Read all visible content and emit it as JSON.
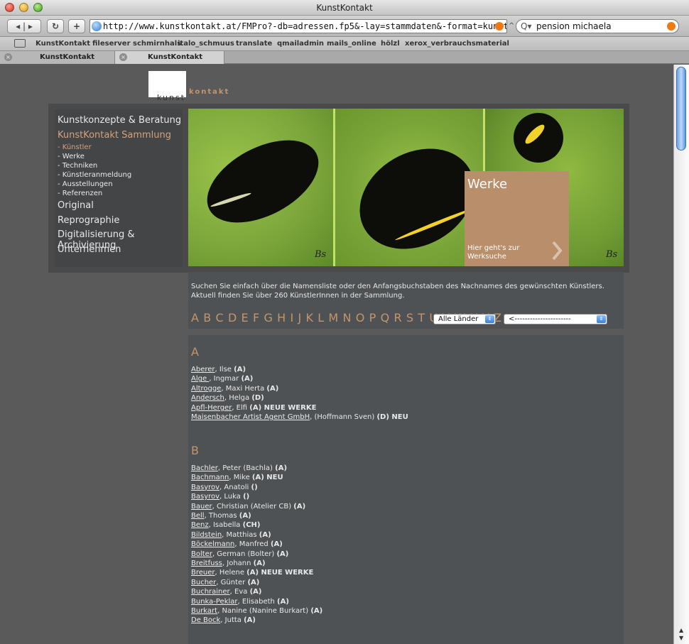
{
  "window": {
    "title": "KunstKontakt"
  },
  "toolbar": {
    "url": "http://www.kunstkontakt.at/FMPro?-db=adressen.fp5&-lay=stammdaten&-format=kunstlerauswahl.html&Ve",
    "search_query": "pension michaela"
  },
  "bookmarks": [
    "KunstKontakt",
    "fileserver schmirnhals",
    "italo_schmuus",
    "translate",
    "qmailadmin",
    "mails_online",
    "hölzl",
    "xerox_verbrauchsmaterial"
  ],
  "tabs": [
    {
      "label": "KunstKontakt"
    },
    {
      "label": "KunstKontakt"
    }
  ],
  "logo": {
    "part1": "kunst",
    "part2": "kontakt"
  },
  "nav": {
    "main": [
      "Kunstkonzepte & Beratung",
      "KunstKontakt Sammlung",
      "Original",
      "Reprographie",
      "Digitalisierung & Archivierung",
      "Unternehmen"
    ],
    "sub": [
      "- Künstler",
      "- Werke",
      "- Techniken",
      "- Künstleranmeldung",
      "- Ausstellungen",
      "- Referenzen"
    ]
  },
  "hero": {
    "box_title": "Werke",
    "box_link": "Hier geht's zur Werksuche",
    "signature": "Bs"
  },
  "search": {
    "intro_line1": "Suchen Sie einfach über die Namensliste oder den Anfangsbuchstaben des Nachnames des gewünschten Künstlers.",
    "intro_line2": "Aktuell finden Sie über 260 KünstlerInnen in der Sammlung.",
    "alphabet": "A B C D E F G H I J K L M N O P Q R S T U V W X Y Z",
    "country_select": "Alle Länder",
    "artist_select": "<----------------------"
  },
  "sections": [
    {
      "letter": "A",
      "entries": [
        {
          "name": "Aberer",
          "rest": ", Ilse ",
          "tag": "(A)",
          "extra": ""
        },
        {
          "name": "Alge ",
          "rest": ", Ingmar ",
          "tag": "(A)",
          "extra": ""
        },
        {
          "name": "Altrogge",
          "rest": ", Maxi Herta ",
          "tag": "(A)",
          "extra": ""
        },
        {
          "name": "Andersch",
          "rest": ", Helga ",
          "tag": "(D)",
          "extra": ""
        },
        {
          "name": "Apfl-Herger",
          "rest": ", Elfi ",
          "tag": "(A)",
          "extra": " NEUE WERKE"
        },
        {
          "name": "Maisenbacher Artist Agent GmbH",
          "rest": ", (Hoffmann Sven) ",
          "tag": "(D)",
          "extra": " NEU"
        }
      ]
    },
    {
      "letter": "B",
      "entries": [
        {
          "name": "Bachler",
          "rest": ", Peter (Bachla) ",
          "tag": "(A)",
          "extra": ""
        },
        {
          "name": "Bachmann",
          "rest": ", Mike ",
          "tag": "(A)",
          "extra": " NEU"
        },
        {
          "name": "Basyrov",
          "rest": ", Anatoli ",
          "tag": "()",
          "extra": ""
        },
        {
          "name": "Basyrov",
          "rest": ", Luka ",
          "tag": "()",
          "extra": ""
        },
        {
          "name": "Bauer",
          "rest": ", Christian (Atelier CB) ",
          "tag": "(A)",
          "extra": ""
        },
        {
          "name": "Bell",
          "rest": ", Thomas ",
          "tag": "(A)",
          "extra": ""
        },
        {
          "name": "Benz",
          "rest": ", Isabella ",
          "tag": "(CH)",
          "extra": ""
        },
        {
          "name": "Bildstein",
          "rest": ", Matthias ",
          "tag": "(A)",
          "extra": ""
        },
        {
          "name": "Böckelmann",
          "rest": ", Manfred ",
          "tag": "(A)",
          "extra": ""
        },
        {
          "name": "Bolter",
          "rest": ", German (Bolter) ",
          "tag": "(A)",
          "extra": ""
        },
        {
          "name": "Breitfuss",
          "rest": ", Johann ",
          "tag": "(A)",
          "extra": ""
        },
        {
          "name": "Breuer",
          "rest": ", Helene ",
          "tag": "(A)",
          "extra": " NEUE WERKE"
        },
        {
          "name": "Bucher",
          "rest": ", Günter ",
          "tag": "(A)",
          "extra": ""
        },
        {
          "name": "Buchrainer",
          "rest": ", Eva ",
          "tag": "(A)",
          "extra": ""
        },
        {
          "name": "Bunka-Peklar",
          "rest": ", Elisabeth ",
          "tag": "(A)",
          "extra": ""
        },
        {
          "name": "Burkart",
          "rest": ", Nanine (Nanine Burkart) ",
          "tag": "(A)",
          "extra": ""
        },
        {
          "name": "De Bock",
          "rest": ", Jutta ",
          "tag": "(A)",
          "extra": ""
        }
      ]
    }
  ]
}
